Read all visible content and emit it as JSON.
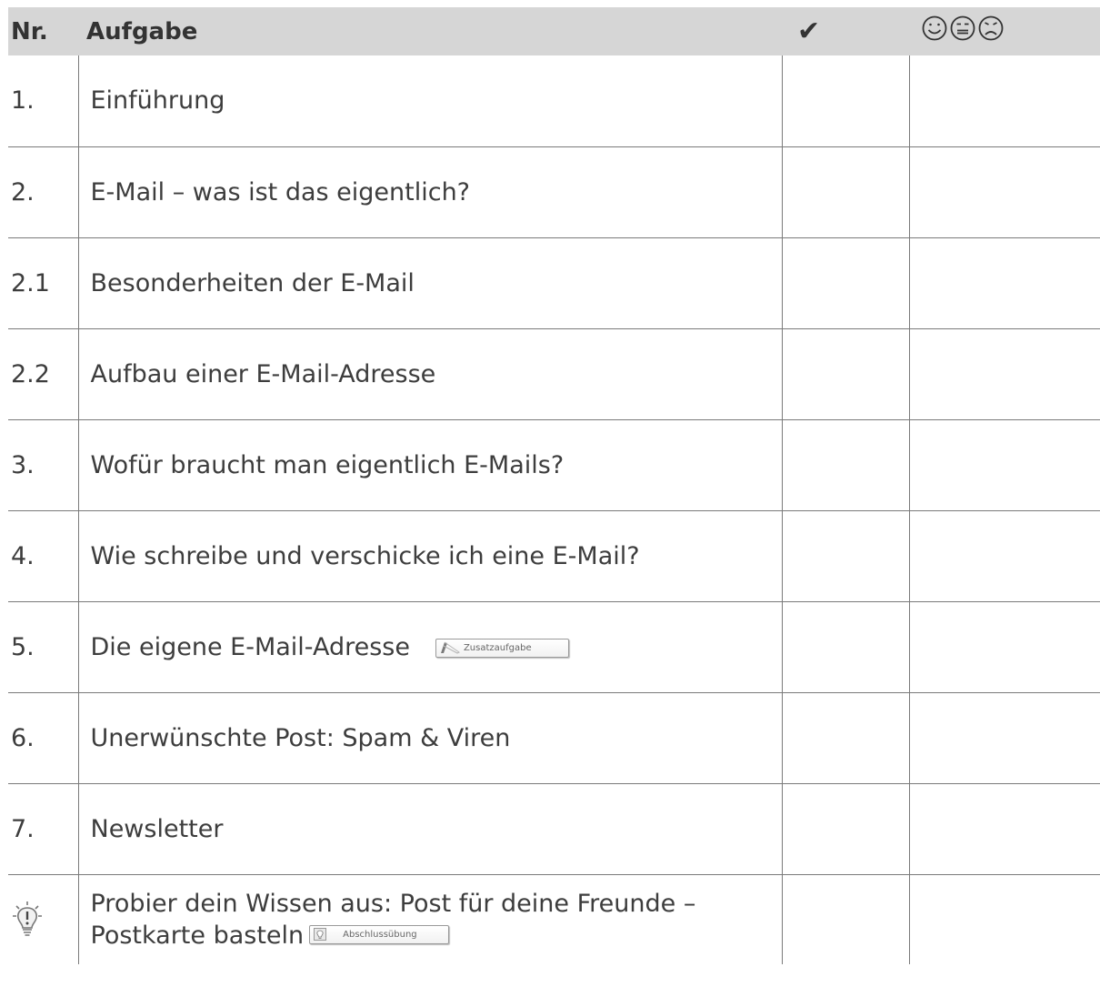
{
  "header": {
    "nr": "Nr.",
    "task": "Aufgabe",
    "done_icon": "check-mark-icon",
    "done_symbol": "✔",
    "mood_symbols": "☺☹☹",
    "mood_icons": [
      "smiley-happy-icon",
      "smiley-neutral-icon",
      "smiley-sad-icon"
    ]
  },
  "rows": [
    {
      "nr": "1.",
      "task": "Einführung"
    },
    {
      "nr": "2.",
      "task": "E-Mail – was ist das eigentlich?"
    },
    {
      "nr": "2.1",
      "task": "Besonderheiten der E-Mail"
    },
    {
      "nr": "2.2",
      "task": "Aufbau einer E-Mail-Adresse"
    },
    {
      "nr": "3.",
      "task": "Wofür braucht man eigentlich E-Mails?"
    },
    {
      "nr": "4.",
      "task": "Wie schreibe und verschicke ich eine E-Mail?"
    },
    {
      "nr": "5.",
      "task": "Die eigene E-Mail-Adresse",
      "badge": "Zusatzaufgabe",
      "badge_icon": "pencil-icon"
    },
    {
      "nr": "6.",
      "task": "Unerwünschte Post: Spam & Viren"
    },
    {
      "nr": "7.",
      "task": "Newsletter"
    },
    {
      "nr_icon": "lightbulb-icon",
      "task_line1": "Probier dein Wissen aus: Post für deine Freunde –",
      "task_line2": "Postkarte basteln",
      "badge": "Abschlussübung",
      "badge_icon": "lightbulb-icon"
    }
  ]
}
